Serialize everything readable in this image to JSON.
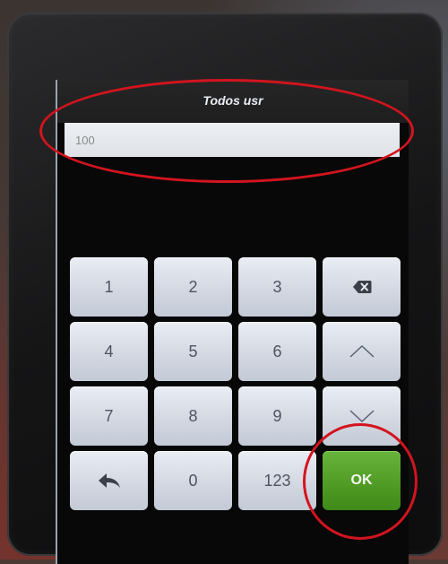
{
  "screen": {
    "title": "Todos usr",
    "input_value": "100"
  },
  "keypad": {
    "rows": [
      [
        {
          "label": "1"
        },
        {
          "label": "2"
        },
        {
          "label": "3"
        },
        {
          "icon": "backspace-icon"
        }
      ],
      [
        {
          "label": "4"
        },
        {
          "label": "5"
        },
        {
          "label": "6"
        },
        {
          "icon": "chevron-up-icon"
        }
      ],
      [
        {
          "label": "7"
        },
        {
          "label": "8"
        },
        {
          "label": "9"
        },
        {
          "icon": "chevron-down-icon"
        }
      ],
      [
        {
          "icon": "back-arrow-icon"
        },
        {
          "label": "0"
        },
        {
          "label": "123"
        },
        {
          "label": "OK"
        }
      ]
    ]
  },
  "colors": {
    "ok_button": "#4e9a24",
    "annotation": "#d3141e",
    "key_face": "#d3d8e2"
  }
}
